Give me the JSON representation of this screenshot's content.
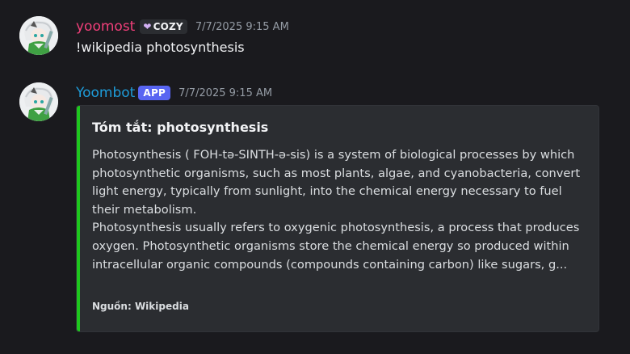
{
  "messages": [
    {
      "username": "yoomost",
      "role_tag": "COZY",
      "role_icon": "heart-icon",
      "timestamp": "7/7/2025 9:15 AM",
      "content": "!wikipedia photosynthesis",
      "username_color": "#f23f7a"
    },
    {
      "username": "Yoombot",
      "app_tag": "APP",
      "timestamp": "7/7/2025 9:15 AM",
      "username_color": "#1e9bd8",
      "embed": {
        "title": "Tóm tắt: photosynthesis",
        "paragraph1": "Photosynthesis ( FOH-tə-SINTH-ə-sis) is a system of biological processes by which photosynthetic organisms, such as most plants, algae, and cyanobacteria, convert light energy, typically from sunlight, into the chemical energy necessary to fuel their metabolism.",
        "paragraph2": "Photosynthesis usually refers to oxygenic photosynthesis, a process that produces oxygen. Photosynthetic organisms store the chemical energy so produced within intracellular organic compounds (compounds containing carbon) like sugars, g...",
        "footer": "Nguồn: Wikipedia",
        "accent_color": "#1ec71e"
      }
    }
  ]
}
